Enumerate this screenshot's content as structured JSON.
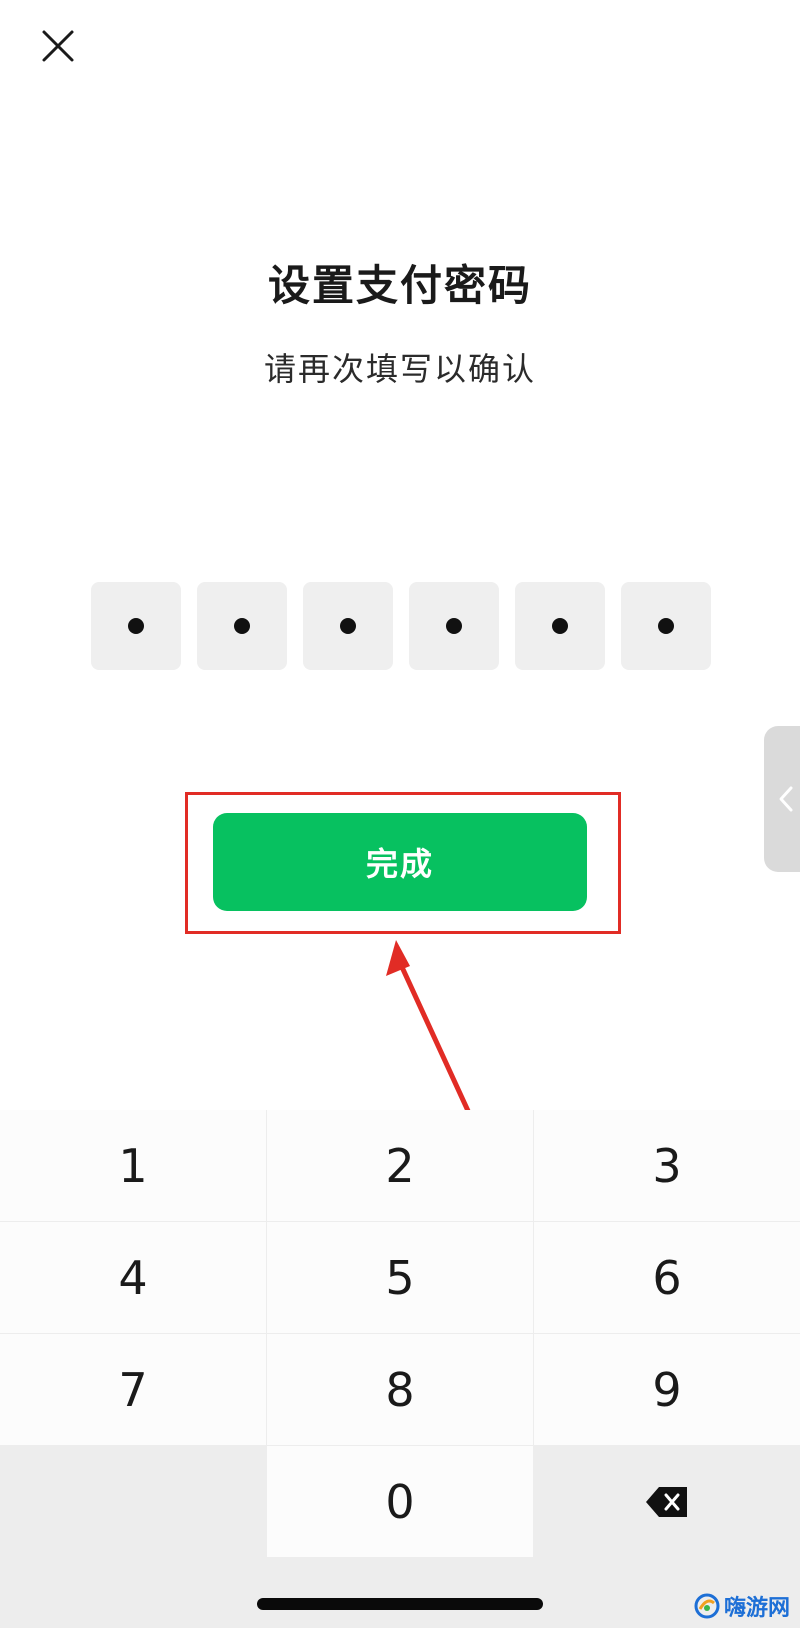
{
  "header": {
    "close_icon": "close-icon"
  },
  "content": {
    "title": "设置支付密码",
    "subtitle": "请再次填写以确认"
  },
  "pin": {
    "length": 6,
    "filled": 6
  },
  "actions": {
    "done_label": "完成"
  },
  "side_tab": {
    "icon": "chevron-left-icon"
  },
  "keypad": {
    "keys": [
      "1",
      "2",
      "3",
      "4",
      "5",
      "6",
      "7",
      "8",
      "9",
      "",
      "0",
      "backspace"
    ]
  },
  "watermark": {
    "text": "嗨游网"
  },
  "colors": {
    "accent_green": "#07c160",
    "highlight_red": "#e12c25",
    "keypad_bg": "#ededed",
    "pin_box_bg": "#efefef"
  }
}
